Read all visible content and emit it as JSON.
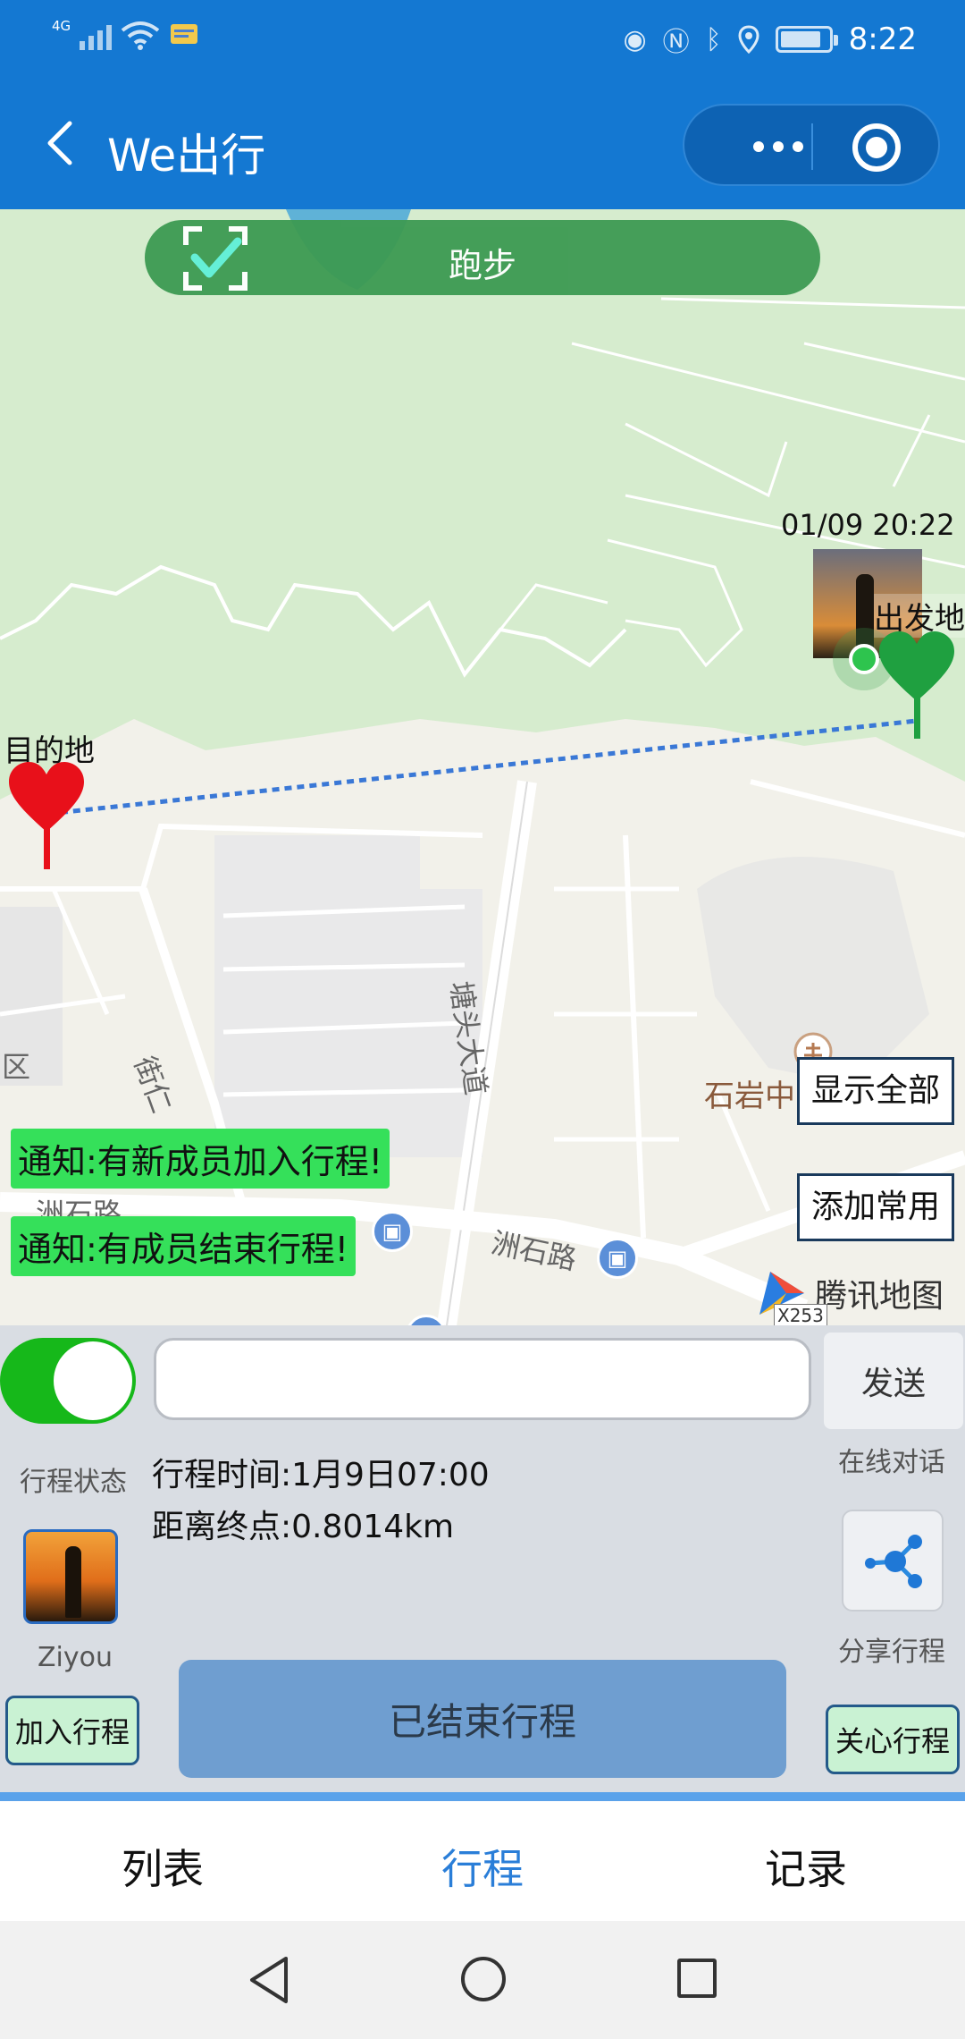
{
  "status_bar": {
    "network": "4G",
    "time": "8:22",
    "icons": [
      "signal-icon",
      "wifi-icon",
      "message-icon",
      "eye-icon",
      "nfc-icon",
      "bluetooth-icon",
      "location-icon",
      "battery-icon"
    ]
  },
  "nav": {
    "title": "We出行",
    "icons": [
      "back-icon",
      "more-icon",
      "target-icon"
    ]
  },
  "map": {
    "activity_pill": "跑步",
    "timestamp": "01/09 20:22",
    "start_label": "出发地",
    "destination_label": "目的地",
    "show_all_button": "显示全部",
    "add_favorite_button": "添加常用",
    "road_labels": {
      "tangtou": "塘头大道",
      "zhoushi": "洲石路",
      "zhoushi_partial": "洲石路",
      "jieren": "街仁",
      "district": "区"
    },
    "poi_label": "石岩中",
    "provider": "腾讯地图",
    "road_code": "X253",
    "notifications": [
      "通知:有新成员加入行程!",
      "通知:有成员结束行程!"
    ]
  },
  "panel": {
    "toggle_on": true,
    "message_input": {
      "value": "",
      "placeholder": ""
    },
    "send_button": "发送",
    "online_chat_label": "在线对话",
    "trip_status_label": "行程状态",
    "trip_time": "行程时间:1月9日07:00",
    "distance_to_end": "距离终点:0.8014km",
    "avatar_name": "Ziyou",
    "share_label": "分享行程",
    "join_button": "加入行程",
    "ended_button": "已结束行程",
    "care_button": "关心行程"
  },
  "tabs": [
    {
      "label": "列表",
      "active": false
    },
    {
      "label": "行程",
      "active": true
    },
    {
      "label": "记录",
      "active": false
    }
  ],
  "colors": {
    "primary_blue": "#1478d2",
    "active_tab": "#2a7ed8",
    "notice_green": "#35e05a",
    "toggle_green": "#16b81a",
    "heart_red": "#e8101a",
    "heart_green": "#1fa040"
  }
}
